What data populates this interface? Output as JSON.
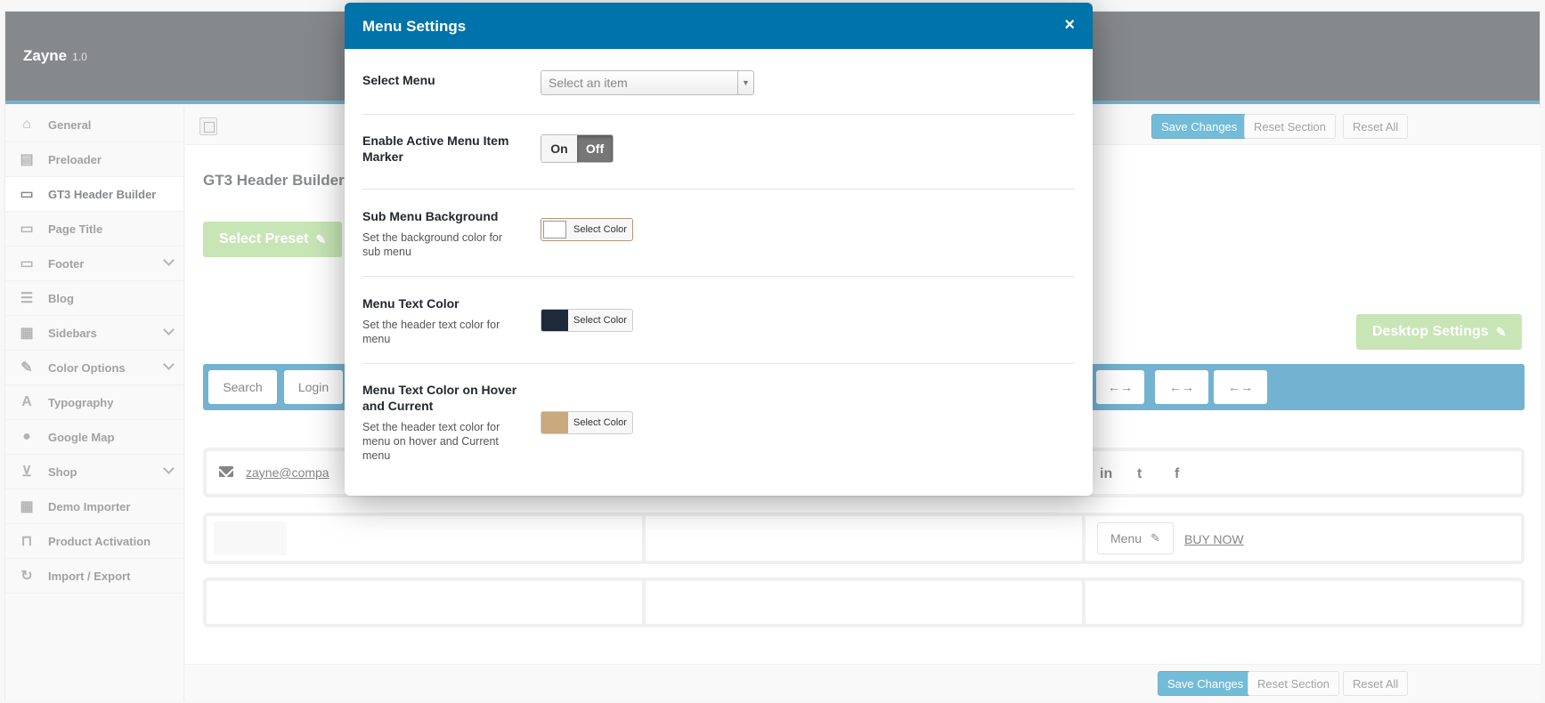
{
  "brand": {
    "name": "Zayne",
    "version": "1.0"
  },
  "sidebar": {
    "items": [
      {
        "label": "General",
        "icon": "home-icon",
        "active": false,
        "expandable": false
      },
      {
        "label": "Preloader",
        "icon": "chart-icon",
        "active": false,
        "expandable": false
      },
      {
        "label": "GT3 Header Builder",
        "icon": "monitor-icon",
        "active": true,
        "expandable": false
      },
      {
        "label": "Page Title",
        "icon": "monitor-icon",
        "active": false,
        "expandable": false
      },
      {
        "label": "Footer",
        "icon": "monitor-icon",
        "active": false,
        "expandable": true
      },
      {
        "label": "Blog",
        "icon": "list-icon",
        "active": false,
        "expandable": false
      },
      {
        "label": "Sidebars",
        "icon": "layout-icon",
        "active": false,
        "expandable": true
      },
      {
        "label": "Color Options",
        "icon": "brush-icon",
        "active": false,
        "expandable": true
      },
      {
        "label": "Typography",
        "icon": "font-icon",
        "active": false,
        "expandable": false
      },
      {
        "label": "Google Map",
        "icon": "map-pin-icon",
        "active": false,
        "expandable": false
      },
      {
        "label": "Shop",
        "icon": "cart-icon",
        "active": false,
        "expandable": true
      },
      {
        "label": "Demo Importer",
        "icon": "layout-icon",
        "active": false,
        "expandable": false
      },
      {
        "label": "Product Activation",
        "icon": "unlock-icon",
        "active": false,
        "expandable": false
      },
      {
        "label": "Import / Export",
        "icon": "refresh-icon",
        "active": false,
        "expandable": false
      }
    ]
  },
  "toolbar": {
    "save_label": "Save Changes",
    "reset_section_label": "Reset Section",
    "reset_all_label": "Reset All"
  },
  "main": {
    "title": "GT3 Header Builder",
    "select_preset_label": "Select Preset",
    "desktop_settings_label": "Desktop Settings",
    "bar_buttons": [
      "Search",
      "Login"
    ],
    "arrow_buttons": [
      "←→",
      "←→",
      "←→"
    ],
    "email": "zayne@compa",
    "social": [
      "in",
      "t",
      "f"
    ],
    "menu_chip": "Menu",
    "buy_now": "BUY NOW"
  },
  "modal": {
    "title": "Menu Settings",
    "close_glyph": "×",
    "select_menu": {
      "label": "Select Menu",
      "placeholder": "Select an item"
    },
    "active_marker": {
      "label": "Enable Active Menu Item Marker",
      "on": "On",
      "off": "Off",
      "value": "Off"
    },
    "sub_bg": {
      "label": "Sub Menu Background",
      "desc": "Set the background color for sub menu",
      "button": "Select Color",
      "color": "#ffffff"
    },
    "text_color": {
      "label": "Menu Text Color",
      "desc": "Set the header text color for menu",
      "button": "Select Color",
      "color": "#1e2a3a"
    },
    "hover_color": {
      "label": "Menu Text Color on Hover and Current",
      "desc": "Set the header text color for menu on hover and Current menu",
      "button": "Select Color",
      "color": "#c9a97d"
    }
  },
  "colors": {
    "accent": "#0073aa",
    "primary_button": "#0085ba",
    "green": "#9bd07a",
    "topbar": "#23282d"
  }
}
